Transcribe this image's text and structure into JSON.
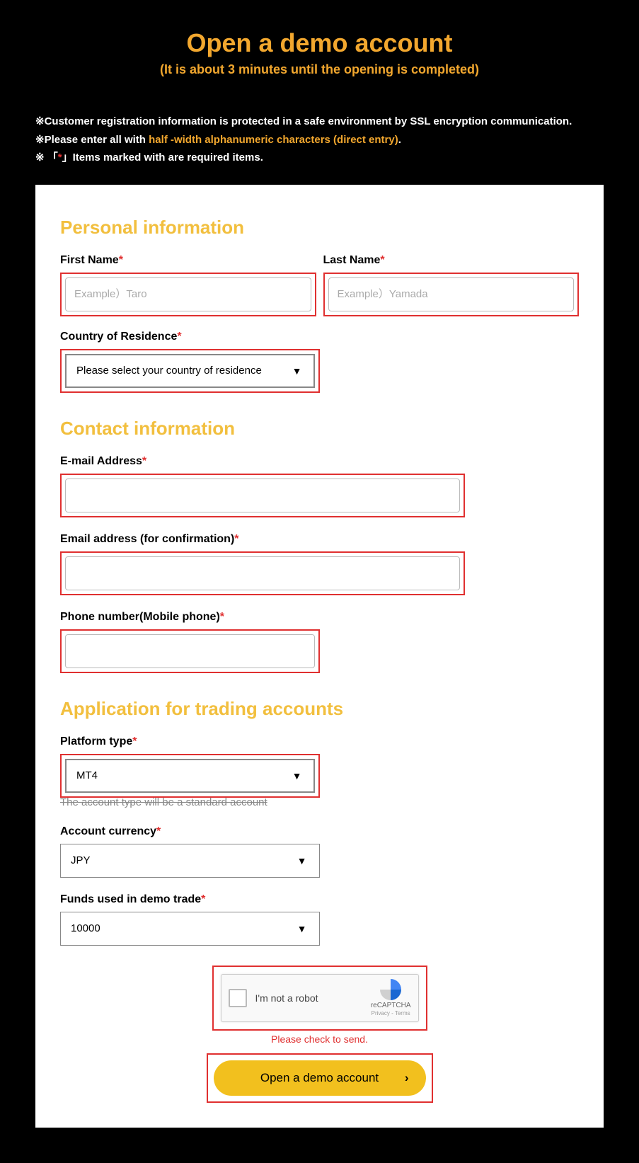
{
  "header": {
    "title": "Open a demo account",
    "subtitle": "(It is about 3 minutes until the opening is completed)"
  },
  "notes": {
    "line1_prefix": "※Customer registration information is protected in a safe environment by SSL encryption communication.",
    "line2_prefix": "※Please enter all with ",
    "line2_orange": "half -width alphanumeric characters (direct entry)",
    "line2_suffix": ".",
    "line3_prefix": "※ 「",
    "line3_asterisk": "*",
    "line3_suffix": "」Items marked with are required items."
  },
  "sections": {
    "personal": "Personal information",
    "contact": "Contact information",
    "trading": "Application for trading accounts"
  },
  "fields": {
    "first_name": {
      "label": "First Name",
      "placeholder": "Example）Taro"
    },
    "last_name": {
      "label": "Last Name",
      "placeholder": "Example）Yamada"
    },
    "country": {
      "label": "Country of Residence",
      "placeholder": "Please select your country of residence"
    },
    "email": {
      "label": "E-mail Address"
    },
    "email_confirm": {
      "label": "Email address (for confirmation)"
    },
    "phone": {
      "label": "Phone number(Mobile phone)"
    },
    "platform": {
      "label": "Platform type",
      "value": "MT4",
      "note": "The account type will be a standard account"
    },
    "currency": {
      "label": "Account currency",
      "value": "JPY"
    },
    "funds": {
      "label": "Funds used in demo trade",
      "value": "10000"
    }
  },
  "captcha": {
    "label": "I'm not a robot",
    "brand": "reCAPTCHA",
    "privacy": "Privacy",
    "terms": "Terms",
    "error": "Please check to send."
  },
  "submit": {
    "label": "Open a demo account"
  },
  "asterisk": "*"
}
